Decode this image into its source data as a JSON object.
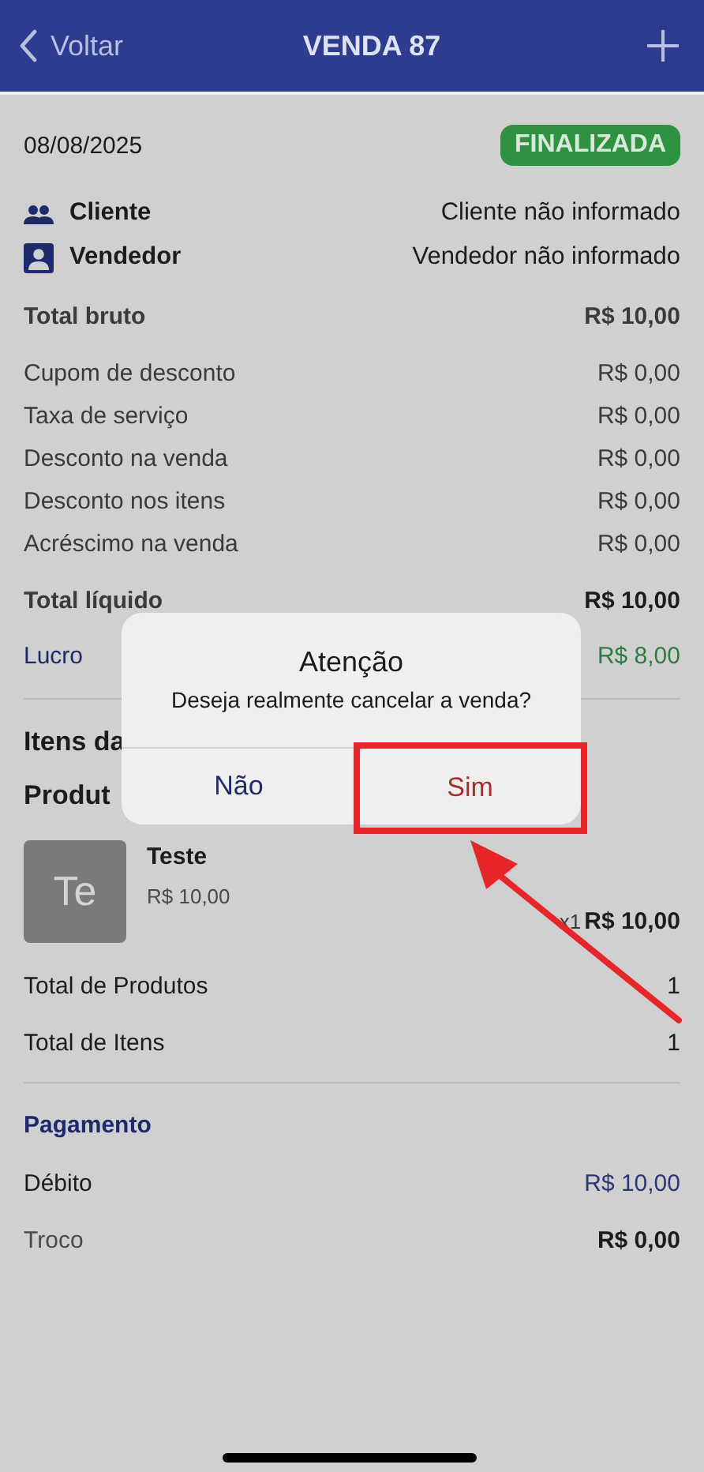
{
  "header": {
    "back_label": "Voltar",
    "title": "VENDA 87"
  },
  "sale": {
    "date": "08/08/2025",
    "status": "FINALIZADA"
  },
  "people": [
    {
      "kind": "client",
      "label": "Cliente",
      "value": "Cliente não informado"
    },
    {
      "kind": "seller",
      "label": "Vendedor",
      "value": "Vendedor não informado"
    }
  ],
  "totals": [
    {
      "kind": "bold",
      "label": "Total bruto",
      "value": "R$ 10,00"
    },
    {
      "kind": "plain",
      "label": "Cupom de desconto",
      "value": "R$ 0,00"
    },
    {
      "kind": "plain",
      "label": "Taxa de serviço",
      "value": "R$ 0,00"
    },
    {
      "kind": "plain",
      "label": "Desconto na venda",
      "value": "R$ 0,00"
    },
    {
      "kind": "plain",
      "label": "Desconto nos itens",
      "value": "R$ 0,00"
    },
    {
      "kind": "plain",
      "label": "Acréscimo na venda",
      "value": "R$ 0,00"
    },
    {
      "kind": "total",
      "label": "Total líquido",
      "value": "R$ 10,00"
    },
    {
      "kind": "profit",
      "label": "Lucro",
      "value": "R$ 8,00"
    }
  ],
  "items_heading": "Itens da",
  "products_heading": "Produt",
  "products": [
    {
      "initials": "Te",
      "name": "Teste",
      "unit_price": "R$ 10,00",
      "quantity": "x1",
      "total": "R$ 10,00"
    }
  ],
  "summary": [
    {
      "label": "Total de Produtos",
      "value": "1"
    },
    {
      "label": "Total de Itens",
      "value": "1"
    }
  ],
  "payment": {
    "heading": "Pagamento",
    "rows": [
      {
        "kind": "method",
        "label": "Débito",
        "value": "R$ 10,00"
      },
      {
        "kind": "change",
        "label": "Troco",
        "value": "R$ 0,00"
      }
    ]
  },
  "dialog": {
    "title": "Atenção",
    "message": "Deseja realmente cancelar a venda?",
    "buttons": [
      {
        "kind": "cancel",
        "label": "Não",
        "highlighted": false
      },
      {
        "kind": "confirm",
        "label": "Sim",
        "highlighted": true
      }
    ]
  }
}
